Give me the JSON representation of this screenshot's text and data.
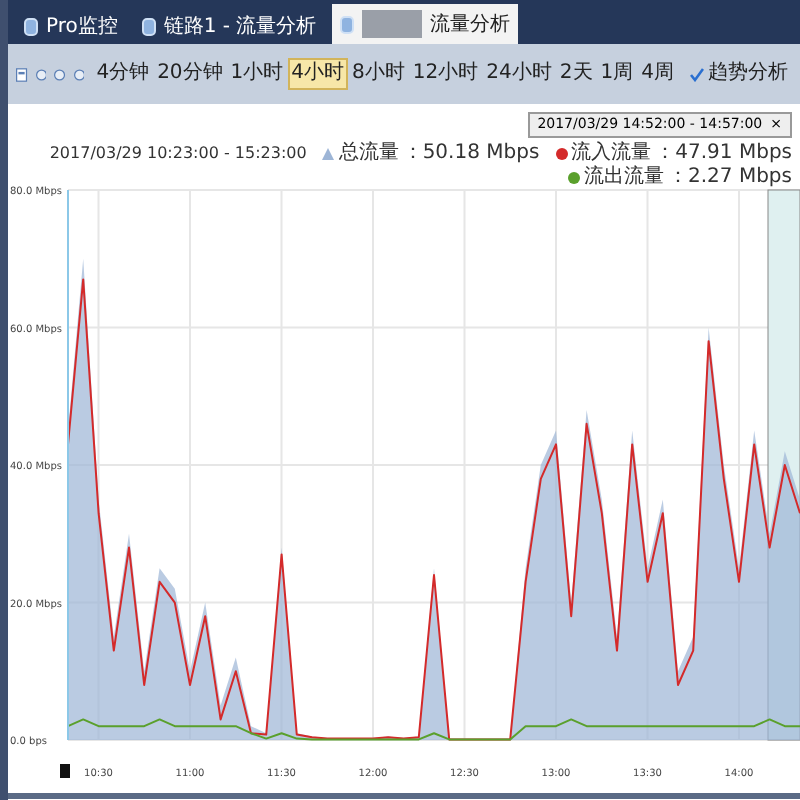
{
  "tabs": [
    {
      "label": "Pro监控",
      "selected": false
    },
    {
      "label": "链路1 - 流量分析",
      "selected": false
    },
    {
      "label": "流量分析",
      "selected": true
    }
  ],
  "time_ranges": [
    {
      "label": "4分钟",
      "selected": false
    },
    {
      "label": "20分钟",
      "selected": false
    },
    {
      "label": "1小时",
      "selected": false
    },
    {
      "label": "4小时",
      "selected": true
    },
    {
      "label": "8小时",
      "selected": false
    },
    {
      "label": "12小时",
      "selected": false
    },
    {
      "label": "24小时",
      "selected": false
    },
    {
      "label": "2天",
      "selected": false
    },
    {
      "label": "1周",
      "selected": false
    },
    {
      "label": "4周",
      "selected": false
    }
  ],
  "trend_button": {
    "label": "趋势分析",
    "checked": true
  },
  "tooltip": {
    "text": "2017/03/29 14:52:00 - 14:57:00",
    "close": "×"
  },
  "legend": {
    "range": "2017/03/29 10:23:00 - 15:23:00",
    "items": [
      {
        "value": "：50.18 Mbps",
        "color": "#9db5d6"
      },
      {
        "value": "：47.91 Mbps",
        "color": "#d42a2a"
      },
      {
        "value": "：2.27 Mbps",
        "color": "#5aa02c"
      }
    ]
  },
  "chart_data": {
    "type": "area",
    "grid": true,
    "categories": [
      null,
      null,
      "10:30",
      null,
      null,
      null,
      null,
      null,
      "11:00",
      null,
      null,
      null,
      null,
      null,
      "11:30",
      null,
      null,
      null,
      null,
      null,
      "12:00",
      null,
      null,
      null,
      null,
      null,
      "12:30",
      null,
      null,
      null,
      null,
      null,
      "13:00",
      null,
      null,
      null,
      null,
      null,
      "13:30",
      null,
      null,
      null,
      null,
      null,
      "14:00",
      null,
      null,
      null,
      null
    ],
    "series": [
      {
        "name": "总流量",
        "color": "#9db5d6",
        "values": [
          45,
          70,
          35,
          15,
          30,
          10,
          25,
          22,
          10,
          20,
          5,
          12,
          2,
          1,
          28,
          1,
          0.5,
          0.3,
          0.3,
          0.3,
          0.3,
          0.5,
          0.3,
          0.5,
          25,
          0.2,
          0.2,
          0.2,
          0.2,
          0.2,
          25,
          40,
          45,
          20,
          48,
          35,
          15,
          45,
          25,
          35,
          10,
          15,
          60,
          40,
          25,
          45,
          30,
          42,
          35
        ]
      },
      {
        "name": "流入流量",
        "type": "line",
        "color": "#d42a2a",
        "values": [
          43,
          67,
          33,
          13,
          28,
          8,
          23,
          20,
          8,
          18,
          3,
          10,
          1,
          0.8,
          27,
          0.8,
          0.4,
          0.2,
          0.2,
          0.2,
          0.2,
          0.4,
          0.2,
          0.4,
          24,
          0.1,
          0.1,
          0.1,
          0.1,
          0.1,
          23,
          38,
          43,
          18,
          46,
          33,
          13,
          43,
          23,
          33,
          8,
          13,
          58,
          38,
          23,
          43,
          28,
          40,
          33
        ]
      },
      {
        "name": "流出流量",
        "type": "line",
        "color": "#5aa02c",
        "values": [
          2,
          3,
          2,
          2,
          2,
          2,
          3,
          2,
          2,
          2,
          2,
          2,
          1,
          0.2,
          1,
          0.2,
          0.1,
          0.1,
          0.1,
          0.1,
          0.1,
          0.1,
          0.1,
          0.1,
          1,
          0.1,
          0.1,
          0.1,
          0.1,
          0.1,
          2,
          2,
          2,
          3,
          2,
          2,
          2,
          2,
          2,
          2,
          2,
          2,
          2,
          2,
          2,
          2,
          3,
          2,
          2
        ]
      }
    ],
    "ylim": [
      0,
      80
    ],
    "yticks": [
      {
        "value": 0,
        "label": "0.0 bps"
      },
      {
        "value": 20,
        "label": "20.0 Mbps"
      },
      {
        "value": 40,
        "label": "40.0 Mbps"
      },
      {
        "value": 60,
        "label": "60.0 Mbps"
      },
      {
        "value": 80,
        "label": "80.0 Mbps"
      }
    ]
  }
}
